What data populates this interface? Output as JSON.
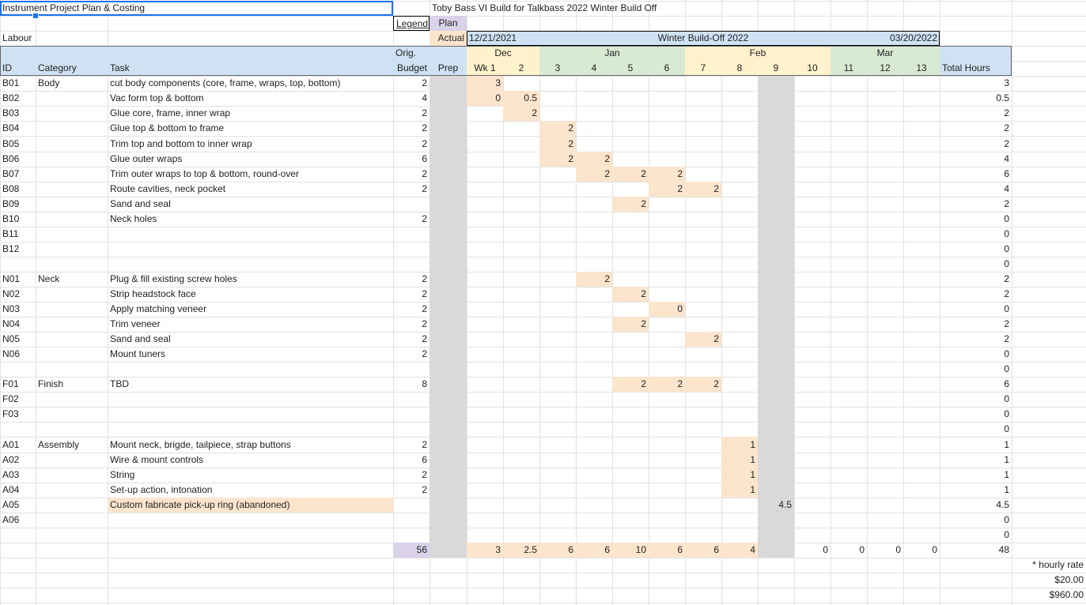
{
  "colors": {
    "grid": "#e2e2e2",
    "blue": "#cfe2f3",
    "green": "#d9ead3",
    "yellow": "#fff2cc",
    "orange": "#fce5cd",
    "gray": "#d9d9d9",
    "purple": "#d9d2e9",
    "selection": "#1a73e8"
  },
  "sheet": {
    "title": "Instrument Project Plan & Costing",
    "build_title": "Toby Bass VI Build for Talkbass 2022 Winter Build Off",
    "section": "Labour",
    "legend_label": "Legend",
    "legend_plan": "Plan",
    "legend_actual": "Actual",
    "start_date": "12/21/2021",
    "build_off_label": "Winter Build-Off 2022",
    "end_date": "03/20/2022",
    "hourly_rate_label": "* hourly rate",
    "hourly_rate": "$20.00",
    "total_cost": "$960.00"
  },
  "months": [
    {
      "label": "Dec",
      "color": "yellow"
    },
    {
      "label": "Jan",
      "color": "green"
    },
    {
      "label": "Feb",
      "color": "yellow"
    },
    {
      "label": "Mar",
      "color": "green"
    }
  ],
  "headers": {
    "id": "ID",
    "category": "Category",
    "task": "Task",
    "orig": "Orig.",
    "budget": "Budget",
    "prep": "Prep",
    "weeks": [
      "Wk 1",
      "2",
      "3",
      "4",
      "5",
      "6",
      "7",
      "8",
      "9",
      "10",
      "11",
      "12",
      "13"
    ],
    "total": "Total Hours"
  },
  "rows": [
    {
      "id": "B01",
      "category": "Body",
      "task": "cut body components (core, frame, wraps, top, bottom)",
      "budget": "2",
      "weeks": [
        "3",
        "",
        "",
        "",
        "",
        "",
        "",
        "",
        "",
        "",
        "",
        "",
        ""
      ],
      "fills": [
        1,
        0,
        0,
        0,
        0,
        0,
        0,
        0,
        0,
        0,
        0,
        0,
        0
      ],
      "total": "3"
    },
    {
      "id": "B02",
      "category": "",
      "task": "Vac form top & bottom",
      "budget": "4",
      "weeks": [
        "0",
        "0.5",
        "",
        "",
        "",
        "",
        "",
        "",
        "",
        "",
        "",
        "",
        ""
      ],
      "fills": [
        1,
        1,
        0,
        0,
        0,
        0,
        0,
        0,
        0,
        0,
        0,
        0,
        0
      ],
      "total": "0.5"
    },
    {
      "id": "B03",
      "category": "",
      "task": "Glue core, frame, inner wrap",
      "budget": "2",
      "weeks": [
        "",
        "2",
        "",
        "",
        "",
        "",
        "",
        "",
        "",
        "",
        "",
        "",
        ""
      ],
      "fills": [
        0,
        1,
        0,
        0,
        0,
        0,
        0,
        0,
        0,
        0,
        0,
        0,
        0
      ],
      "total": "2"
    },
    {
      "id": "B04",
      "category": "",
      "task": "Glue top & bottom to frame",
      "budget": "2",
      "weeks": [
        "",
        "",
        "2",
        "",
        "",
        "",
        "",
        "",
        "",
        "",
        "",
        "",
        ""
      ],
      "fills": [
        0,
        0,
        1,
        0,
        0,
        0,
        0,
        0,
        0,
        0,
        0,
        0,
        0
      ],
      "total": "2"
    },
    {
      "id": "B05",
      "category": "",
      "task": "Trim top and bottom to inner wrap",
      "budget": "2",
      "weeks": [
        "",
        "",
        "2",
        "",
        "",
        "",
        "",
        "",
        "",
        "",
        "",
        "",
        ""
      ],
      "fills": [
        0,
        0,
        1,
        0,
        0,
        0,
        0,
        0,
        0,
        0,
        0,
        0,
        0
      ],
      "total": "2"
    },
    {
      "id": "B06",
      "category": "",
      "task": "Glue outer wraps",
      "budget": "6",
      "weeks": [
        "",
        "",
        "2",
        "2",
        "",
        "",
        "",
        "",
        "",
        "",
        "",
        "",
        ""
      ],
      "fills": [
        0,
        0,
        1,
        1,
        0,
        0,
        0,
        0,
        0,
        0,
        0,
        0,
        0
      ],
      "total": "4"
    },
    {
      "id": "B07",
      "category": "",
      "task": "Trim outer wraps to top & bottom, round-over",
      "budget": "2",
      "weeks": [
        "",
        "",
        "",
        "2",
        "2",
        "2",
        "",
        "",
        "",
        "",
        "",
        "",
        ""
      ],
      "fills": [
        0,
        0,
        0,
        1,
        1,
        1,
        0,
        0,
        0,
        0,
        0,
        0,
        0
      ],
      "total": "6"
    },
    {
      "id": "B08",
      "category": "",
      "task": "Route cavities, neck pocket",
      "budget": "2",
      "weeks": [
        "",
        "",
        "",
        "",
        "",
        "2",
        "2",
        "",
        "",
        "",
        "",
        "",
        ""
      ],
      "fills": [
        0,
        0,
        0,
        0,
        0,
        1,
        1,
        0,
        0,
        0,
        0,
        0,
        0
      ],
      "total": "4"
    },
    {
      "id": "B09",
      "category": "",
      "task": "Sand and seal",
      "budget": "",
      "weeks": [
        "",
        "",
        "",
        "",
        "2",
        "",
        "",
        "",
        "",
        "",
        "",
        "",
        ""
      ],
      "fills": [
        0,
        0,
        0,
        0,
        1,
        0,
        0,
        0,
        0,
        0,
        0,
        0,
        0
      ],
      "total": "2"
    },
    {
      "id": "B10",
      "category": "",
      "task": "Neck holes",
      "budget": "2",
      "weeks": [
        "",
        "",
        "",
        "",
        "",
        "",
        "",
        "",
        "",
        "",
        "",
        "",
        ""
      ],
      "fills": [
        0,
        0,
        0,
        0,
        0,
        0,
        0,
        0,
        0,
        0,
        0,
        0,
        0
      ],
      "total": "0"
    },
    {
      "id": "B11",
      "category": "",
      "task": "",
      "budget": "",
      "weeks": [
        "",
        "",
        "",
        "",
        "",
        "",
        "",
        "",
        "",
        "",
        "",
        "",
        ""
      ],
      "fills": [
        0,
        0,
        0,
        0,
        0,
        0,
        0,
        0,
        0,
        0,
        0,
        0,
        0
      ],
      "total": "0"
    },
    {
      "id": "B12",
      "category": "",
      "task": "",
      "budget": "",
      "weeks": [
        "",
        "",
        "",
        "",
        "",
        "",
        "",
        "",
        "",
        "",
        "",
        "",
        ""
      ],
      "fills": [
        0,
        0,
        0,
        0,
        0,
        0,
        0,
        0,
        0,
        0,
        0,
        0,
        0
      ],
      "total": "0"
    },
    {
      "id": "",
      "category": "",
      "task": "",
      "budget": "",
      "weeks": [
        "",
        "",
        "",
        "",
        "",
        "",
        "",
        "",
        "",
        "",
        "",
        "",
        ""
      ],
      "fills": [
        0,
        0,
        0,
        0,
        0,
        0,
        0,
        0,
        0,
        0,
        0,
        0,
        0
      ],
      "total": "0"
    },
    {
      "id": "N01",
      "category": "Neck",
      "task": "Plug & fill existing screw holes",
      "budget": "2",
      "weeks": [
        "",
        "",
        "",
        "2",
        "",
        "",
        "",
        "",
        "",
        "",
        "",
        "",
        ""
      ],
      "fills": [
        0,
        0,
        0,
        1,
        0,
        0,
        0,
        0,
        0,
        0,
        0,
        0,
        0
      ],
      "total": "2"
    },
    {
      "id": "N02",
      "category": "",
      "task": "Strip headstock face",
      "budget": "2",
      "weeks": [
        "",
        "",
        "",
        "",
        "2",
        "",
        "",
        "",
        "",
        "",
        "",
        "",
        ""
      ],
      "fills": [
        0,
        0,
        0,
        0,
        1,
        0,
        0,
        0,
        0,
        0,
        0,
        0,
        0
      ],
      "total": "2"
    },
    {
      "id": "N03",
      "category": "",
      "task": "Apply matching veneer",
      "budget": "2",
      "weeks": [
        "",
        "",
        "",
        "",
        "",
        "0",
        "",
        "",
        "",
        "",
        "",
        "",
        ""
      ],
      "fills": [
        0,
        0,
        0,
        0,
        0,
        1,
        0,
        0,
        0,
        0,
        0,
        0,
        0
      ],
      "total": "0"
    },
    {
      "id": "N04",
      "category": "",
      "task": "Trim veneer",
      "budget": "2",
      "weeks": [
        "",
        "",
        "",
        "",
        "2",
        "",
        "",
        "",
        "",
        "",
        "",
        "",
        ""
      ],
      "fills": [
        0,
        0,
        0,
        0,
        1,
        0,
        0,
        0,
        0,
        0,
        0,
        0,
        0
      ],
      "total": "2"
    },
    {
      "id": "N05",
      "category": "",
      "task": "Sand and seal",
      "budget": "2",
      "weeks": [
        "",
        "",
        "",
        "",
        "",
        "",
        "2",
        "",
        "",
        "",
        "",
        "",
        ""
      ],
      "fills": [
        0,
        0,
        0,
        0,
        0,
        0,
        1,
        0,
        0,
        0,
        0,
        0,
        0
      ],
      "total": "2"
    },
    {
      "id": "N06",
      "category": "",
      "task": "Mount tuners",
      "budget": "2",
      "weeks": [
        "",
        "",
        "",
        "",
        "",
        "",
        "",
        "",
        "",
        "",
        "",
        "",
        ""
      ],
      "fills": [
        0,
        0,
        0,
        0,
        0,
        0,
        0,
        0,
        0,
        0,
        0,
        0,
        0
      ],
      "total": "0"
    },
    {
      "id": "",
      "category": "",
      "task": "",
      "budget": "",
      "weeks": [
        "",
        "",
        "",
        "",
        "",
        "",
        "",
        "",
        "",
        "",
        "",
        "",
        ""
      ],
      "fills": [
        0,
        0,
        0,
        0,
        0,
        0,
        0,
        0,
        0,
        0,
        0,
        0,
        0
      ],
      "total": "0"
    },
    {
      "id": "F01",
      "category": "Finish",
      "task": "TBD",
      "budget": "8",
      "weeks": [
        "",
        "",
        "",
        "",
        "2",
        "2",
        "2",
        "",
        "",
        "",
        "",
        "",
        ""
      ],
      "fills": [
        0,
        0,
        0,
        0,
        1,
        1,
        1,
        0,
        0,
        0,
        0,
        0,
        0
      ],
      "total": "6"
    },
    {
      "id": "F02",
      "category": "",
      "task": "",
      "budget": "",
      "weeks": [
        "",
        "",
        "",
        "",
        "",
        "",
        "",
        "",
        "",
        "",
        "",
        "",
        ""
      ],
      "fills": [
        0,
        0,
        0,
        0,
        0,
        0,
        0,
        0,
        0,
        0,
        0,
        0,
        0
      ],
      "total": "0"
    },
    {
      "id": "F03",
      "category": "",
      "task": "",
      "budget": "",
      "weeks": [
        "",
        "",
        "",
        "",
        "",
        "",
        "",
        "",
        "",
        "",
        "",
        "",
        ""
      ],
      "fills": [
        0,
        0,
        0,
        0,
        0,
        0,
        0,
        0,
        0,
        0,
        0,
        0,
        0
      ],
      "total": "0"
    },
    {
      "id": "",
      "category": "",
      "task": "",
      "budget": "",
      "weeks": [
        "",
        "",
        "",
        "",
        "",
        "",
        "",
        "",
        "",
        "",
        "",
        "",
        ""
      ],
      "fills": [
        0,
        0,
        0,
        0,
        0,
        0,
        0,
        0,
        0,
        0,
        0,
        0,
        0
      ],
      "total": "0"
    },
    {
      "id": "A01",
      "category": "Assembly",
      "task": "Mount neck, brigde, tailpiece, strap buttons",
      "budget": "2",
      "weeks": [
        "",
        "",
        "",
        "",
        "",
        "",
        "",
        "1",
        "",
        "",
        "",
        "",
        ""
      ],
      "fills": [
        0,
        0,
        0,
        0,
        0,
        0,
        0,
        1,
        0,
        0,
        0,
        0,
        0
      ],
      "total": "1"
    },
    {
      "id": "A02",
      "category": "",
      "task": "Wire & mount controls",
      "budget": "6",
      "weeks": [
        "",
        "",
        "",
        "",
        "",
        "",
        "",
        "1",
        "",
        "",
        "",
        "",
        ""
      ],
      "fills": [
        0,
        0,
        0,
        0,
        0,
        0,
        0,
        1,
        0,
        0,
        0,
        0,
        0
      ],
      "total": "1"
    },
    {
      "id": "A03",
      "category": "",
      "task": "String",
      "budget": "2",
      "weeks": [
        "",
        "",
        "",
        "",
        "",
        "",
        "",
        "1",
        "",
        "",
        "",
        "",
        ""
      ],
      "fills": [
        0,
        0,
        0,
        0,
        0,
        0,
        0,
        1,
        0,
        0,
        0,
        0,
        0
      ],
      "total": "1"
    },
    {
      "id": "A04",
      "category": "",
      "task": "Set-up action, intonation",
      "budget": "2",
      "weeks": [
        "",
        "",
        "",
        "",
        "",
        "",
        "",
        "1",
        "",
        "",
        "",
        "",
        ""
      ],
      "fills": [
        0,
        0,
        0,
        0,
        0,
        0,
        0,
        1,
        0,
        0,
        0,
        0,
        0
      ],
      "total": "1"
    },
    {
      "id": "A05",
      "category": "",
      "task": "Custom fabricate pick-up ring (abandoned)",
      "budget": "",
      "weeks": [
        "",
        "",
        "",
        "",
        "",
        "",
        "",
        "",
        "4.5",
        "",
        "",
        "",
        ""
      ],
      "fills": [
        0,
        0,
        0,
        0,
        0,
        0,
        0,
        0,
        0,
        0,
        0,
        0,
        0
      ],
      "total": "4.5",
      "task_fill": true
    },
    {
      "id": "A06",
      "category": "",
      "task": "",
      "budget": "",
      "weeks": [
        "",
        "",
        "",
        "",
        "",
        "",
        "",
        "",
        "",
        "",
        "",
        "",
        ""
      ],
      "fills": [
        0,
        0,
        0,
        0,
        0,
        0,
        0,
        0,
        0,
        0,
        0,
        0,
        0
      ],
      "total": "0"
    },
    {
      "id": "",
      "category": "",
      "task": "",
      "budget": "",
      "weeks": [
        "",
        "",
        "",
        "",
        "",
        "",
        "",
        "",
        "",
        "",
        "",
        "",
        ""
      ],
      "fills": [
        0,
        0,
        0,
        0,
        0,
        0,
        0,
        0,
        0,
        0,
        0,
        0,
        0
      ],
      "total": "0"
    }
  ],
  "totals": {
    "budget": "56",
    "weeks": [
      "3",
      "2.5",
      "6",
      "6",
      "10",
      "6",
      "6",
      "4",
      "",
      "0",
      "0",
      "0",
      "0"
    ],
    "total": "48"
  }
}
